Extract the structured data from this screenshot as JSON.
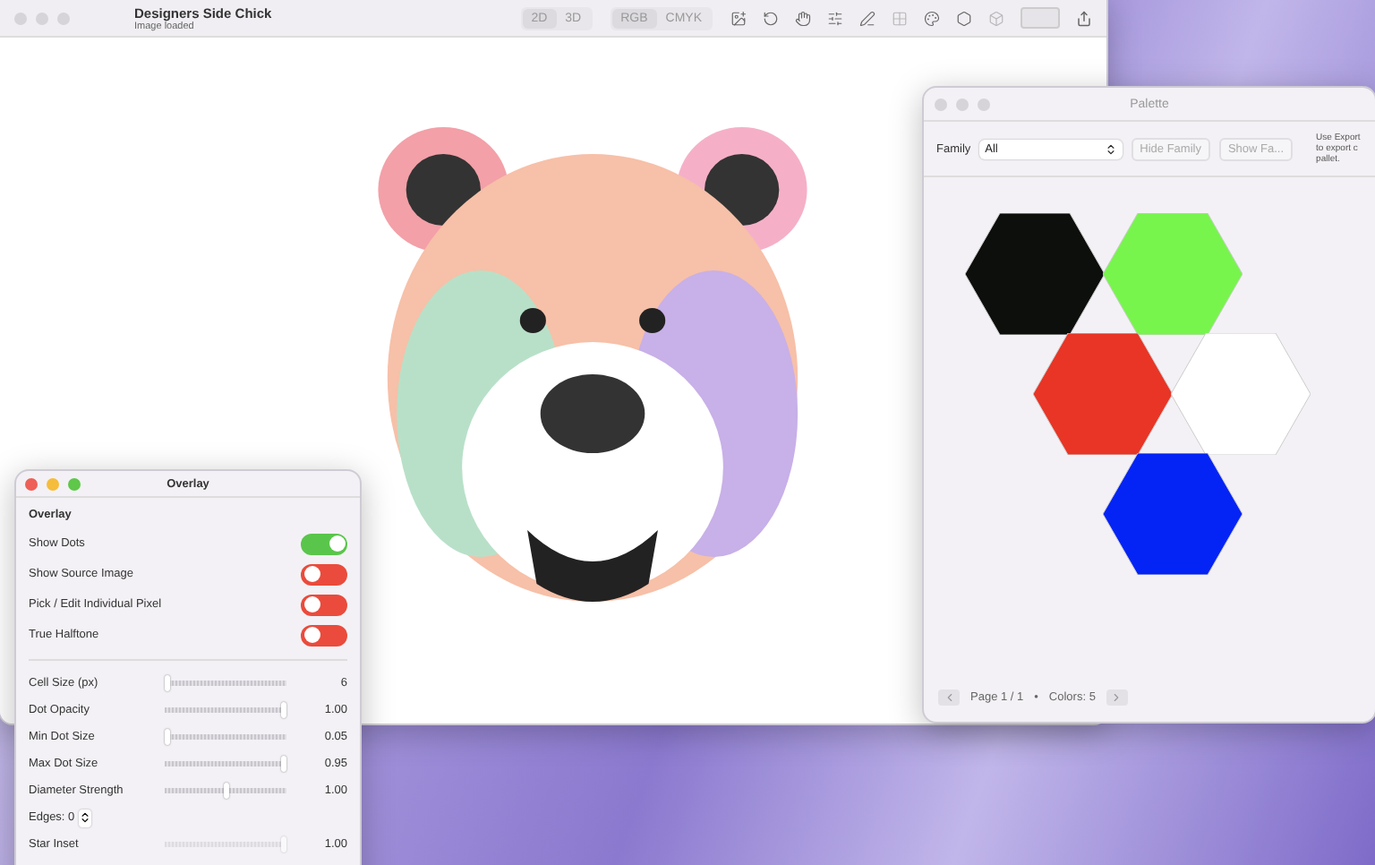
{
  "main_window": {
    "title": "Designers Side Chick",
    "subtitle": "Image loaded",
    "view_modes": [
      {
        "label": "2D",
        "selected": true
      },
      {
        "label": "3D",
        "selected": false
      }
    ],
    "color_modes": [
      {
        "label": "RGB",
        "selected": true
      },
      {
        "label": "CMYK",
        "selected": false
      }
    ]
  },
  "palette_window": {
    "title": "Palette",
    "family_label": "Family",
    "family_value": "All",
    "buttons": [
      "Hide Family",
      "Show Fa..."
    ],
    "note": "Use Export to export c pallet.",
    "swatches": [
      {
        "color": "#0d0f0c"
      },
      {
        "color": "#77f54c"
      },
      {
        "color": "#e83526"
      },
      {
        "color": "#ffffff"
      },
      {
        "color": "#0424f5"
      }
    ],
    "page": "Page 1 / 1",
    "separator": "•",
    "count": "Colors: 5"
  },
  "overlay_window": {
    "title": "Overlay",
    "section": "Overlay",
    "toggles": [
      {
        "label": "Show Dots",
        "on": true
      },
      {
        "label": "Show Source Image",
        "on": false
      },
      {
        "label": "Pick / Edit Individual Pixel",
        "on": false
      },
      {
        "label": "True Halftone",
        "on": false
      }
    ],
    "sliders": [
      {
        "kind": "slider",
        "label": "Cell Size (px)",
        "level": 0,
        "reading": "6",
        "disabled": false
      },
      {
        "kind": "slider",
        "label": "Dot Opacity",
        "level": 1,
        "reading": "1.00",
        "disabled": false
      },
      {
        "kind": "slider",
        "label": "Min Dot Size",
        "level": 0,
        "reading": "0.05",
        "disabled": false
      },
      {
        "kind": "slider",
        "label": "Max Dot Size",
        "level": 1,
        "reading": "0.95",
        "disabled": false
      },
      {
        "kind": "slider",
        "label": "Diameter Strength",
        "level": 0.5,
        "reading": "1.00",
        "disabled": false
      },
      {
        "kind": "stepper",
        "label": "Edges: 0"
      },
      {
        "kind": "slider",
        "label": "Star Inset",
        "level": 1,
        "reading": "1.00",
        "disabled": true
      }
    ]
  }
}
